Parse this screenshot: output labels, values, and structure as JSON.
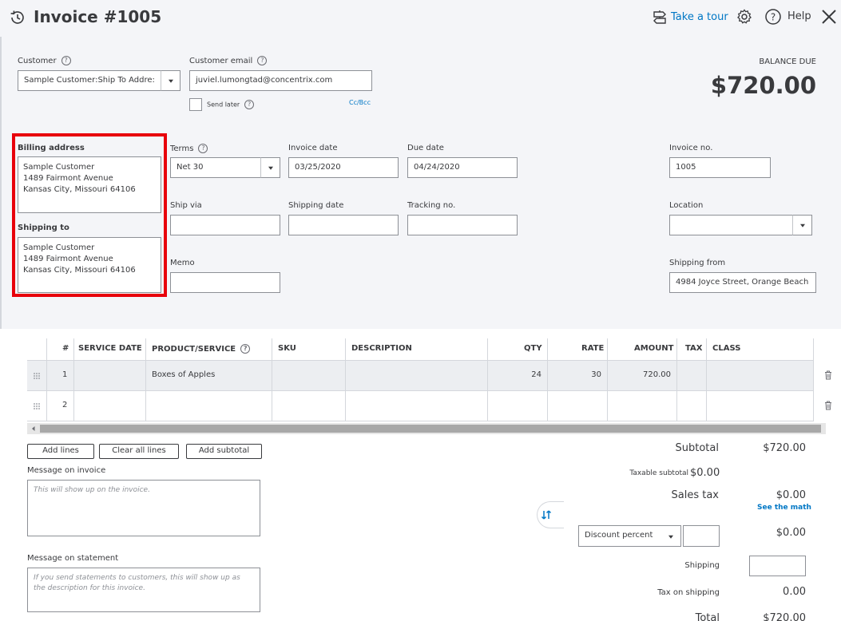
{
  "header": {
    "title": "Invoice #1005",
    "take_tour": "Take a tour",
    "help": "Help"
  },
  "customer": {
    "label": "Customer",
    "value": "Sample Customer:Ship To Addre:",
    "email_label": "Customer email",
    "email_value": "juviel.lumongtad@concentrix.com",
    "send_later": "Send later",
    "cc_bcc": "Cc/Bcc"
  },
  "balance": {
    "label": "BALANCE DUE",
    "amount": "$720.00"
  },
  "billing": {
    "label": "Billing address",
    "lines": [
      "Sample Customer",
      "1489  Fairmont Avenue",
      "Kansas City, Missouri  64106"
    ]
  },
  "shipping": {
    "label": "Shipping to",
    "lines": [
      "Sample Customer",
      "1489  Fairmont Avenue",
      "Kansas City, Missouri  64106"
    ]
  },
  "fields": {
    "terms_label": "Terms",
    "terms_value": "Net 30",
    "invoice_date_label": "Invoice date",
    "invoice_date_value": "03/25/2020",
    "due_date_label": "Due date",
    "due_date_value": "04/24/2020",
    "invoice_no_label": "Invoice no.",
    "invoice_no_value": "1005",
    "ship_via_label": "Ship via",
    "shipping_date_label": "Shipping date",
    "tracking_label": "Tracking no.",
    "location_label": "Location",
    "memo_label": "Memo",
    "shipping_from_label": "Shipping from",
    "shipping_from_value": "4984  Joyce Street, Orange Beach"
  },
  "table": {
    "headers": {
      "num": "#",
      "service_date": "SERVICE DATE",
      "product": "PRODUCT/SERVICE",
      "sku": "SKU",
      "description": "DESCRIPTION",
      "qty": "QTY",
      "rate": "RATE",
      "amount": "AMOUNT",
      "tax": "TAX",
      "class": "CLASS"
    },
    "rows": [
      {
        "num": "1",
        "product": "Boxes of Apples",
        "qty": "24",
        "rate": "30",
        "amount": "720.00"
      },
      {
        "num": "2",
        "product": "",
        "qty": "",
        "rate": "",
        "amount": ""
      }
    ]
  },
  "actions": {
    "add_lines": "Add lines",
    "clear_all": "Clear all lines",
    "add_subtotal": "Add subtotal"
  },
  "messages": {
    "invoice_label": "Message on invoice",
    "invoice_placeholder": "This will show up on the invoice.",
    "statement_label": "Message on statement",
    "statement_placeholder": "If you send statements to customers, this will show up as the description for this invoice."
  },
  "totals": {
    "subtotal_label": "Subtotal",
    "subtotal_value": "$720.00",
    "taxable_label": "Taxable subtotal",
    "taxable_value": "$0.00",
    "sales_tax_label": "Sales tax",
    "sales_tax_value": "$0.00",
    "see_math": "See the math",
    "discount_select": "Discount percent",
    "discount_value": "$0.00",
    "shipping_label": "Shipping",
    "tax_shipping_label": "Tax on shipping",
    "tax_shipping_value": "0.00",
    "total_label": "Total",
    "total_value": "$720.00"
  },
  "colors": {
    "accent": "#0077c5",
    "highlight_box": "#e8000b",
    "form_bg": "#f4f5f8"
  }
}
